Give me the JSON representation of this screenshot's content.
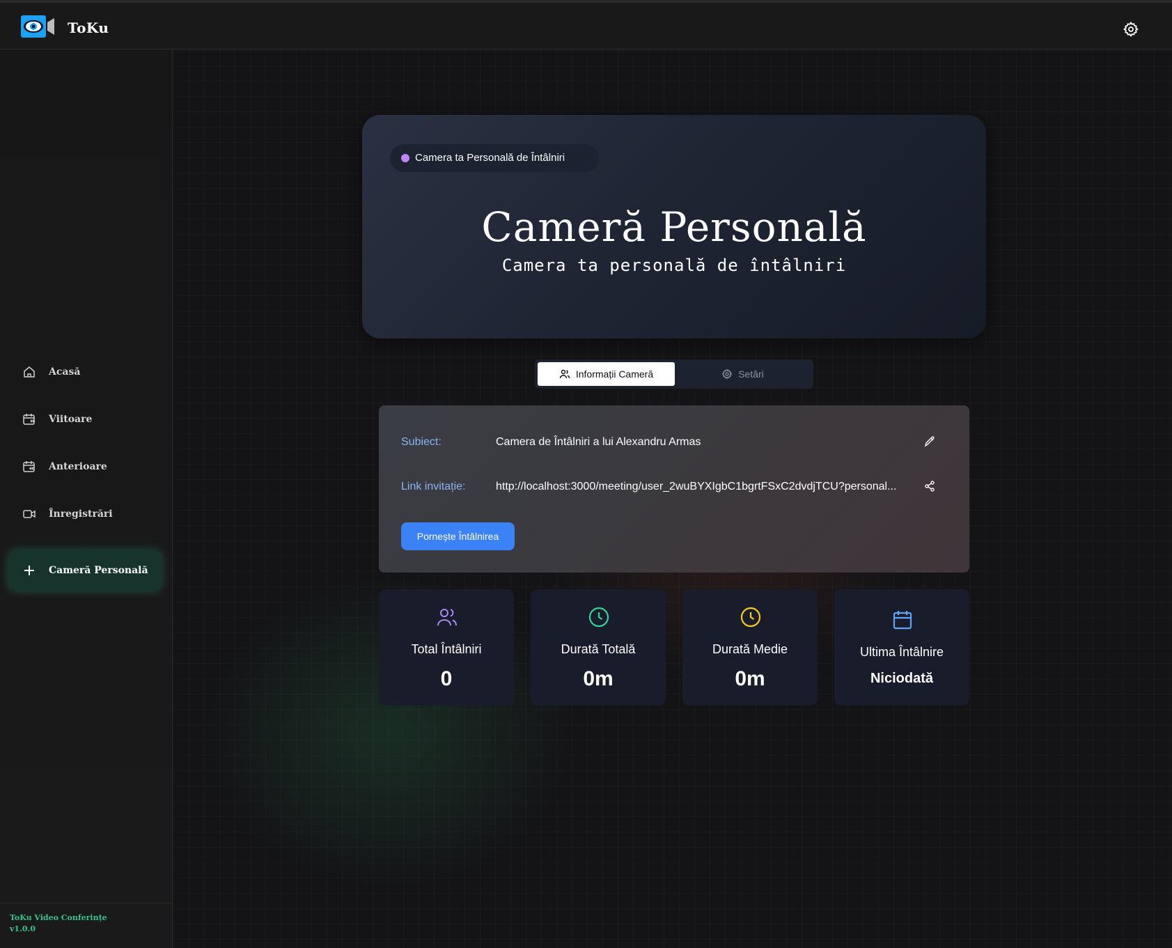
{
  "app": {
    "name": "ToKu"
  },
  "sidebar": {
    "items": [
      {
        "label": "Acasă",
        "icon": "home-icon"
      },
      {
        "label": "Viitoare",
        "icon": "calendar-forward-icon"
      },
      {
        "label": "Anterioare",
        "icon": "calendar-back-icon"
      },
      {
        "label": "Înregistrări",
        "icon": "video-icon"
      },
      {
        "label": "Cameră Personală",
        "icon": "plus-icon",
        "active": true
      }
    ],
    "footer": {
      "product": "ToKu Video Conferințe",
      "version": "v1.0.0"
    }
  },
  "hero": {
    "badge": "Camera ta Personală de Întâlniri",
    "title": "Cameră Personală",
    "subtitle": "Camera ta personală de întâlniri"
  },
  "tabs": [
    {
      "label": "Informații Cameră",
      "icon": "users-icon",
      "active": true
    },
    {
      "label": "Setări",
      "icon": "gear-icon",
      "active": false
    }
  ],
  "info": {
    "subject_label": "Subiect:",
    "subject_value": "Camera de Întâlniri a lui Alexandru Armas",
    "link_label": "Link invitație:",
    "link_value": "http://localhost:3000/meeting/user_2wuBYXIgbC1bgrtFSxC2dvdjTCU?personal...",
    "start_button": "Pornește Întâlnirea"
  },
  "stats": [
    {
      "label": "Total Întâlniri",
      "value": "0",
      "icon": "users-icon",
      "color": "#a78bfa"
    },
    {
      "label": "Durată Totală",
      "value": "0m",
      "icon": "clock-icon",
      "color": "#34d399"
    },
    {
      "label": "Durată Medie",
      "value": "0m",
      "icon": "clock-icon",
      "color": "#facc15"
    },
    {
      "label": "Ultima Întâlnire",
      "value": "Niciodată",
      "icon": "calendar-icon",
      "color": "#60a5fa"
    }
  ],
  "colors": {
    "accent": "#3b82f6",
    "active_nav": "#16332c",
    "footer_text": "#34c38f",
    "badge_dot": "#c084fc"
  }
}
